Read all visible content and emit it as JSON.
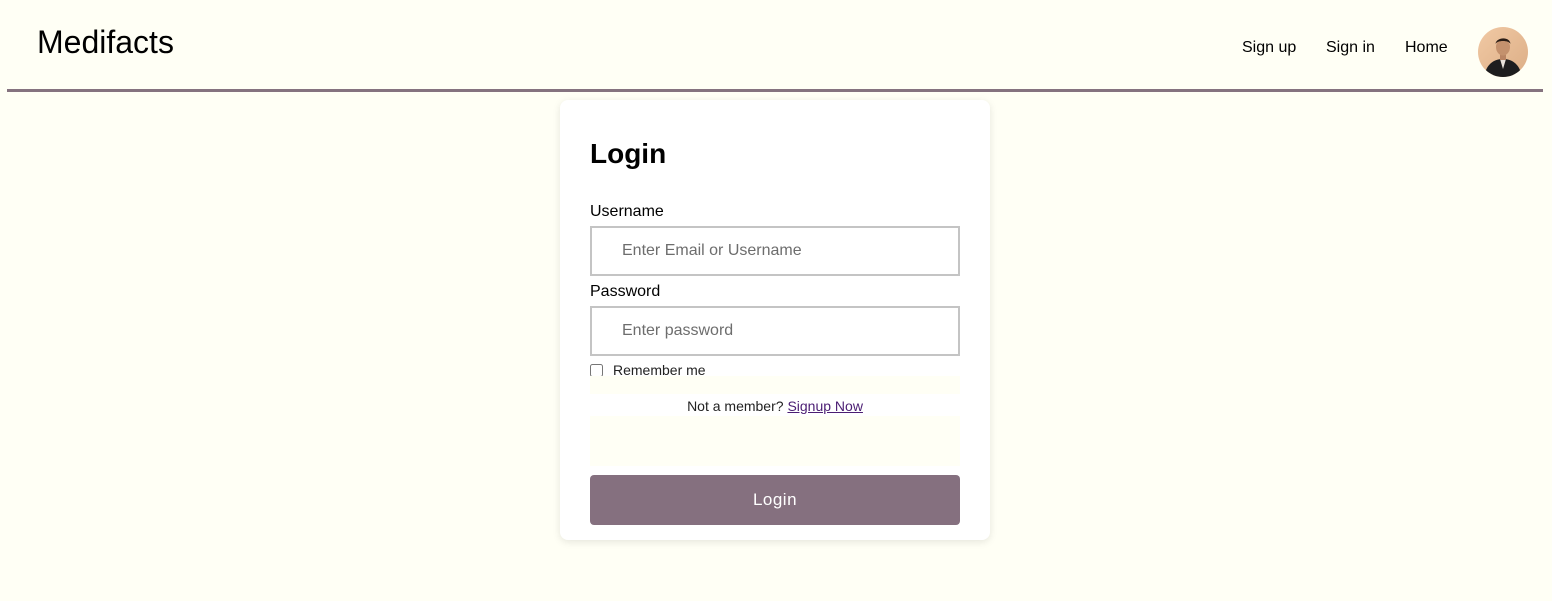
{
  "header": {
    "brand": "Medifacts",
    "nav": [
      {
        "label": "Sign up"
      },
      {
        "label": "Sign in"
      },
      {
        "label": "Home"
      }
    ],
    "avatar_icon": "user-avatar"
  },
  "login": {
    "title": "Login",
    "username": {
      "label": "Username",
      "placeholder": "Enter Email or Username",
      "value": ""
    },
    "password": {
      "label": "Password",
      "placeholder": "Enter password",
      "value": ""
    },
    "remember": {
      "label": "Remember me",
      "checked": false
    },
    "member_prompt": "Not a member?",
    "signup_link": "Signup Now",
    "submit_label": "Login"
  },
  "colors": {
    "page_background": "#fffff5",
    "accent": "#85707f",
    "divider": "#85737f",
    "link": "#4b1d73"
  }
}
